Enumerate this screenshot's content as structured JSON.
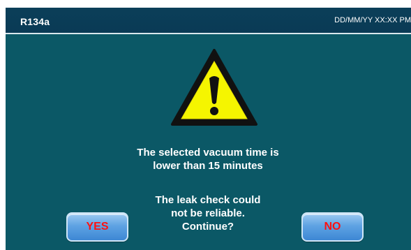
{
  "header": {
    "title": "R134a",
    "datetime": "DD/MM/YY XX:XX PM"
  },
  "dialog": {
    "icon": "warning-triangle-icon",
    "message_1_lines": [
      "The selected vacuum time is",
      "lower than 15 minutes"
    ],
    "message_2_lines": [
      "The leak check could",
      "not be reliable.",
      "Continue?"
    ],
    "yes_label": "YES",
    "no_label": "NO"
  },
  "colors": {
    "background": "#0b5866",
    "header": "#0b3f59",
    "button": "#5fa3e3",
    "button_text": "#ff1111",
    "warning_fill": "#f5f500"
  }
}
